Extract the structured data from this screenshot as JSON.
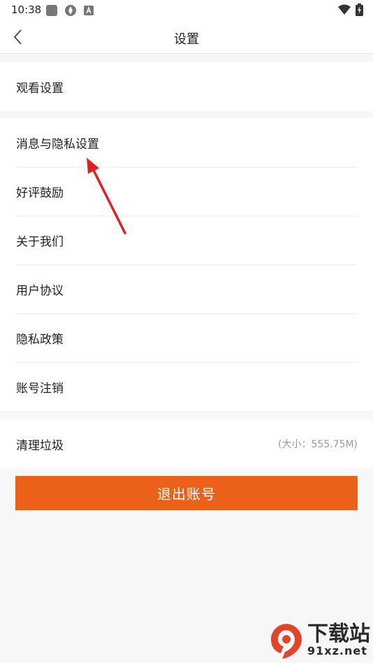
{
  "status_bar": {
    "time": "10:38"
  },
  "header": {
    "title": "设置"
  },
  "groups": [
    {
      "items": [
        {
          "label": "观看设置"
        }
      ]
    },
    {
      "items": [
        {
          "label": "消息与隐私设置"
        },
        {
          "label": "好评鼓励"
        },
        {
          "label": "关于我们"
        },
        {
          "label": "用户协议"
        },
        {
          "label": "隐私政策"
        },
        {
          "label": "账号注销"
        }
      ]
    },
    {
      "items": [
        {
          "label": "清理垃圾",
          "value": "(大小：555.75M)"
        }
      ]
    }
  ],
  "logout_label": "退出账号",
  "watermark": {
    "title": "下载站",
    "domain": "91xz.net"
  },
  "colors": {
    "accent": "#ec6119",
    "annotation": "#e02020"
  },
  "icons": {
    "back": "chevron-left-icon",
    "wifi": "wifi-icon",
    "battery": "battery-charging-icon"
  }
}
